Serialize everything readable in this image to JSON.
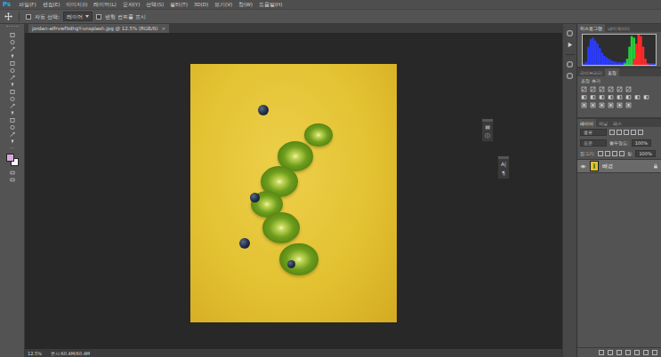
{
  "app": {
    "logo": "Ps"
  },
  "menu": [
    "파일(F)",
    "편집(E)",
    "이미지(I)",
    "레이어(L)",
    "문자(Y)",
    "선택(S)",
    "필터(T)",
    "3D(D)",
    "보기(V)",
    "창(W)",
    "도움말(H)"
  ],
  "options_bar": {
    "auto_select": {
      "label": "자동 선택:",
      "checked": false
    },
    "target": "레이어",
    "transform": {
      "label": "변형 컨트롤 표시",
      "checked": false
    }
  },
  "document_tab": {
    "title": "jordan-alfrvwf9dhgY-unsplash.jpg @ 12.5% (RGB/8)",
    "close": "×"
  },
  "swatches": [
    {
      "name": "foreground",
      "color": "#d7a8dc"
    },
    {
      "name": "background",
      "color": "#ffffff"
    }
  ],
  "floating_panels": [
    {
      "icons": [
        "▤",
        "ⓘ"
      ]
    },
    {
      "icons": [
        "A|",
        "¶"
      ]
    }
  ],
  "histogram_panel": {
    "tabs": [
      {
        "label": "히스토그램",
        "selected": true
      },
      {
        "label": "내비게이터",
        "selected": false
      }
    ],
    "chart": {
      "series": [
        {
          "name": "blue",
          "color": "#2a3cff",
          "values": [
            5,
            10,
            60,
            85,
            90,
            80,
            70,
            55,
            40,
            30,
            25,
            20,
            15,
            12,
            10,
            8,
            8,
            8,
            10,
            12,
            14,
            15,
            15,
            12,
            10,
            8,
            6,
            5,
            5,
            5,
            5,
            5
          ]
        },
        {
          "name": "green",
          "color": "#22d13a",
          "values": [
            0,
            0,
            0,
            0,
            0,
            0,
            0,
            0,
            0,
            0,
            0,
            0,
            0,
            0,
            0,
            0,
            0,
            0,
            5,
            20,
            60,
            95,
            90,
            40,
            10,
            0,
            0,
            0,
            0,
            0,
            0,
            0
          ]
        },
        {
          "name": "red",
          "color": "#ff2a2a",
          "values": [
            0,
            0,
            0,
            0,
            0,
            0,
            0,
            0,
            0,
            0,
            0,
            0,
            0,
            0,
            0,
            0,
            0,
            0,
            0,
            0,
            0,
            0,
            20,
            70,
            100,
            95,
            60,
            20,
            5,
            0,
            0,
            0
          ]
        }
      ]
    }
  },
  "adjustments_panel": {
    "tabs": [
      {
        "label": "라이브러리",
        "selected": false
      },
      {
        "label": "조정",
        "selected": true
      }
    ],
    "label": "조정 추가"
  },
  "layers_panel": {
    "tabs": [
      {
        "label": "레이어",
        "selected": true
      },
      {
        "label": "채널",
        "selected": false
      },
      {
        "label": "패스",
        "selected": false
      }
    ],
    "filter": "종류",
    "blend_mode": "표준",
    "opacity": {
      "label": "불투명도:",
      "value": "100%"
    },
    "lock": "잠그기:",
    "fill": {
      "label": "칠:",
      "value": "100%"
    },
    "layers": [
      {
        "name": "배경",
        "visible": true,
        "selected": true,
        "locked": true
      }
    ]
  },
  "status_bar": {
    "zoom": "12.5%",
    "document": "문서:60.4M/60.4M"
  }
}
